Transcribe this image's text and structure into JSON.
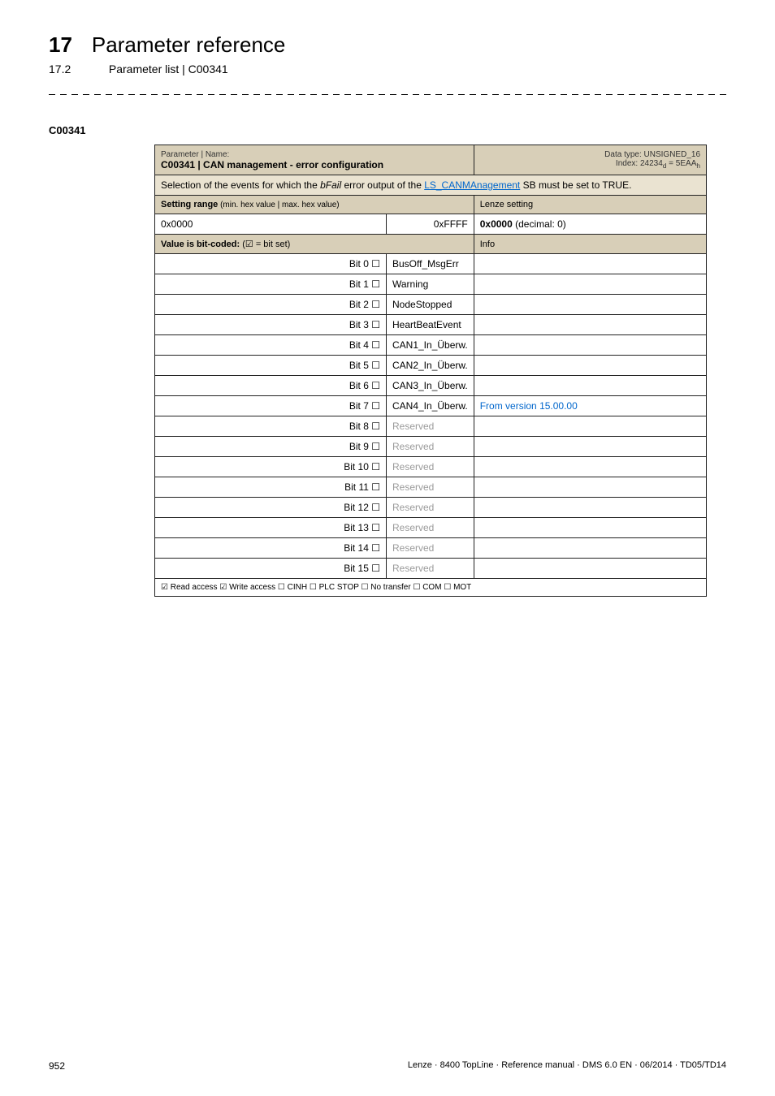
{
  "header": {
    "chapter_num": "17",
    "chapter_title": "Parameter reference",
    "sub_num": "17.2",
    "sub_title": "Parameter list | C00341"
  },
  "param_code": "C00341",
  "table": {
    "top_label": "Parameter | Name:",
    "param_title": "C00341 | CAN management - error configuration",
    "datatype": "Data type: UNSIGNED_16",
    "index": "Index: 24234d = 5EAAh",
    "description_prefix": "Selection of the events for which the ",
    "description_bfail": "bFail",
    "description_mid": " error output of the ",
    "description_link": "LS_CANMAnagement",
    "description_suffix": " SB must be set to TRUE.",
    "setting_range_label": "Setting range",
    "setting_range_hint": " (min. hex value | max. hex value)",
    "lenze_setting_label": "Lenze setting",
    "range_min": "0x0000",
    "range_max": "0xFFFF",
    "default_bold": "0x0000",
    "default_rest": "  (decimal: 0)",
    "bitcoded_label": "Value is bit-coded:",
    "bitcoded_hint": "  (☑ = bit set)",
    "info_label": "Info",
    "bits": [
      {
        "bit": "Bit 0  ☐",
        "name": "BusOff_MsgErr",
        "info": "",
        "reserved": false
      },
      {
        "bit": "Bit 1  ☐",
        "name": "Warning",
        "info": "",
        "reserved": false
      },
      {
        "bit": "Bit 2  ☐",
        "name": "NodeStopped",
        "info": "",
        "reserved": false
      },
      {
        "bit": "Bit 3  ☐",
        "name": "HeartBeatEvent",
        "info": "",
        "reserved": false
      },
      {
        "bit": "Bit 4  ☐",
        "name": "CAN1_In_Überw.",
        "info": "",
        "reserved": false
      },
      {
        "bit": "Bit 5  ☐",
        "name": "CAN2_In_Überw.",
        "info": "",
        "reserved": false
      },
      {
        "bit": "Bit 6  ☐",
        "name": "CAN3_In_Überw.",
        "info": "",
        "reserved": false
      },
      {
        "bit": "Bit 7  ☐",
        "name": "CAN4_In_Überw.",
        "info": "From version 15.00.00",
        "reserved": false,
        "info_link": true
      },
      {
        "bit": "Bit 8  ☐",
        "name": "Reserved",
        "info": "",
        "reserved": true
      },
      {
        "bit": "Bit 9  ☐",
        "name": "Reserved",
        "info": "",
        "reserved": true
      },
      {
        "bit": "Bit 10  ☐",
        "name": "Reserved",
        "info": "",
        "reserved": true
      },
      {
        "bit": "Bit 11  ☐",
        "name": "Reserved",
        "info": "",
        "reserved": true
      },
      {
        "bit": "Bit 12  ☐",
        "name": "Reserved",
        "info": "",
        "reserved": true
      },
      {
        "bit": "Bit 13  ☐",
        "name": "Reserved",
        "info": "",
        "reserved": true
      },
      {
        "bit": "Bit 14  ☐",
        "name": "Reserved",
        "info": "",
        "reserved": true
      },
      {
        "bit": "Bit 15  ☐",
        "name": "Reserved",
        "info": "",
        "reserved": true
      }
    ],
    "access_line": "☑ Read access   ☑ Write access   ☐ CINH   ☐ PLC STOP   ☐ No transfer   ☐ COM   ☐ MOT"
  },
  "footer": {
    "page": "952",
    "meta": "Lenze · 8400 TopLine · Reference manual · DMS 6.0 EN · 06/2014 · TD05/TD14"
  }
}
